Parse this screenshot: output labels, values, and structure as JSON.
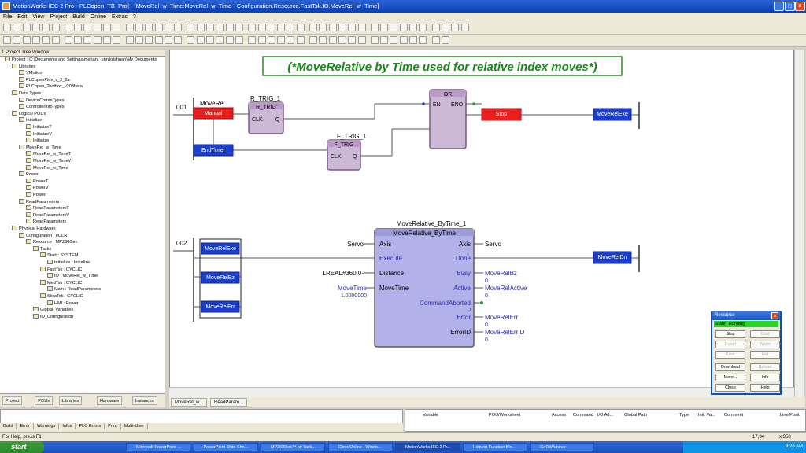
{
  "window": {
    "title": "MotionWorks IEC 2 Pro - PLCopen_TB_Pro] - [MoveRel_w_Time:MoveRel_w_Time - Configuration.Resource.FastTsk.IO.MoveRel_w_Time]"
  },
  "menu": [
    "File",
    "Edit",
    "View",
    "Project",
    "Build",
    "Online",
    "Extras",
    "?"
  ],
  "tree": {
    "header": "1 Project Tree Window",
    "nodes": [
      {
        "t": "Project : C:\\Documents and Settings\\mehant_unnikrishnan\\My Documents",
        "d": 0
      },
      {
        "t": "Libraries",
        "d": 1
      },
      {
        "t": "YMotion",
        "d": 2
      },
      {
        "t": "PLCopenPlus_v_2_2a",
        "d": 2
      },
      {
        "t": "PLCopen_Toolbox_v203beta",
        "d": 2
      },
      {
        "t": "Data Types",
        "d": 1
      },
      {
        "t": "DeviceCommTypes",
        "d": 2
      },
      {
        "t": "ControllerInfoTypes",
        "d": 2
      },
      {
        "t": "Logical POUs",
        "d": 1
      },
      {
        "t": "Initialize",
        "d": 2
      },
      {
        "t": "InitializeT",
        "d": 3
      },
      {
        "t": "InitializeV",
        "d": 3
      },
      {
        "t": "Initialize",
        "d": 3
      },
      {
        "t": "MoveRel_w_Time",
        "d": 2
      },
      {
        "t": "MoveRel_w_TimeT",
        "d": 3
      },
      {
        "t": "MoveRel_w_TimeV",
        "d": 3
      },
      {
        "t": "MoveRel_w_Time",
        "d": 3
      },
      {
        "t": "Power",
        "d": 2
      },
      {
        "t": "PowerT",
        "d": 3
      },
      {
        "t": "PowerV",
        "d": 3
      },
      {
        "t": "Power",
        "d": 3
      },
      {
        "t": "ReadParameters",
        "d": 2
      },
      {
        "t": "ReadParametersT",
        "d": 3
      },
      {
        "t": "ReadParametersV",
        "d": 3
      },
      {
        "t": "ReadParameters",
        "d": 3
      },
      {
        "t": "Physical Hardware",
        "d": 1
      },
      {
        "t": "Configuration : eCLR",
        "d": 2
      },
      {
        "t": "Resource : MP2600iec",
        "d": 3
      },
      {
        "t": "Tasks",
        "d": 4
      },
      {
        "t": "Start : SYSTEM",
        "d": 5
      },
      {
        "t": "Initialize : Initialize",
        "d": 6
      },
      {
        "t": "FastTsk : CYCLIC",
        "d": 5
      },
      {
        "t": "IO : MoveRel_w_Time",
        "d": 6
      },
      {
        "t": "MedTsk : CYCLIC",
        "d": 5
      },
      {
        "t": "Main : ReadParameters",
        "d": 6
      },
      {
        "t": "SlowTsk : CYCLIC",
        "d": 5
      },
      {
        "t": "HMI : Power",
        "d": 6
      },
      {
        "t": "Global_Variables",
        "d": 4
      },
      {
        "t": "IO_Configuration",
        "d": 4
      }
    ]
  },
  "left_tabs": [
    "Project",
    "POUs",
    "Libraries",
    "Hardware",
    "Instances"
  ],
  "doc_tabs": [
    "MoveRel_w...",
    "ReadParam..."
  ],
  "output_tabs": [
    "Build",
    "Error",
    "Warnings",
    "Infos",
    "PLC Errors",
    "Print",
    "Multi-User"
  ],
  "watch_cols": [
    "Variable",
    "POU/Worksheet",
    "Access",
    "Command",
    "I/O Ad...",
    "Global Path",
    "Type",
    "Init. Va...",
    "Comment",
    "Line/Posit"
  ],
  "status": {
    "help": "For Help, press F1",
    "pos": "17,34",
    "zoom": "x:358"
  },
  "taskbar": {
    "start": "start",
    "tasks": [
      "Microsoft PowerPoint ...",
      "PowerPoint Slide Sho...",
      "MP2600iec™ by Yask...",
      "Clinic Online - Windo...",
      "MotionWorks IEC 2 Pr...",
      "Help on Function Blo...",
      "GoToWebinar"
    ],
    "clock": "9:26 AM"
  },
  "diagram": {
    "banner": "(*MoveRelative by Time used for relative index moves*)",
    "r1": {
      "num": "001",
      "var_a": "MoveRel",
      "contact_a": "Manual",
      "contact_b": "EndTimer",
      "rtrig_inst": "R_TRIG_1",
      "rtrig_type": "R_TRIG",
      "clk": "CLK",
      "q": "Q",
      "ftrig_inst": "F_TRIG_1",
      "ftrig_type": "F_TRIG",
      "or_type": "OR",
      "en": "EN",
      "eno": "ENO",
      "coil_stop": "Stop",
      "coil_exe": "MoveRelExe"
    },
    "r2": {
      "num": "002",
      "inst": "MoveRelative_ByTime_1",
      "type": "MoveRelative_ByTime",
      "c1": "MoveRelExe",
      "c2": "MoveRelBz",
      "c3": "MoveRelErr",
      "in_servo": "Servo",
      "in_dist": "LREAL#360.0-",
      "in_mt": "MoveTime",
      "in_mt_val": "1.0000000",
      "p_axis": "Axis",
      "p_exec": "Execute",
      "p_dist": "Distance",
      "p_mt": "MoveTime",
      "o_axis": "Axis",
      "o_done": "Done",
      "o_busy": "Busy",
      "o_active": "Active",
      "o_abort": "CommandAborted",
      "o_err": "Error",
      "o_errid": "ErrorID",
      "out_servo": "Servo",
      "out_busy": "MoveRelBz",
      "out_busy_v": "0",
      "out_active": "MoveRelActive",
      "out_active_v": "0",
      "abort_v": "0",
      "out_err": "MoveRelErr",
      "out_err_v": "0",
      "out_errid": "MoveRelErrID",
      "out_errid_v": "0",
      "coil_dn": "MoveRelDn"
    }
  },
  "resource": {
    "title": "Resource",
    "state_label": "State",
    "state": "Running",
    "buttons": [
      [
        "Stop",
        "Cold"
      ],
      [
        "Reset",
        "Warm"
      ],
      [
        "Error",
        "Hot"
      ],
      [
        "Download",
        "Upload"
      ],
      [
        "More...",
        "Info"
      ],
      [
        "Close",
        "Help"
      ]
    ]
  },
  "colors": {
    "fb_fill": "#ccb9d6",
    "fb_big": "#b3b1ea",
    "contact_red": "#e82020",
    "contact_blue": "#1a3fcf",
    "coil_green": "#2ca02c"
  }
}
